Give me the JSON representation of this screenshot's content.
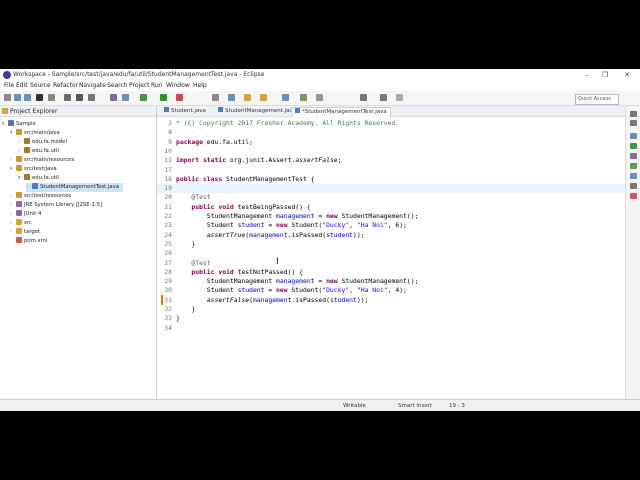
{
  "window": {
    "title": "Workspace - Sample/src/test/java/edu/fa/util/StudentManagementTest.java - Eclipse"
  },
  "menu": [
    "File",
    "Edit",
    "Source",
    "Refactor",
    "Navigate",
    "Search",
    "Project",
    "Run",
    "Window",
    "Help"
  ],
  "quick_access": "Quick Access",
  "explorer": {
    "title": "Project Explorer",
    "items": [
      {
        "label": "Sample"
      },
      {
        "label": "src/main/java"
      },
      {
        "label": "edu.fa.model"
      },
      {
        "label": "edu.fa.util"
      },
      {
        "label": "src/main/resources"
      },
      {
        "label": "src/test/java"
      },
      {
        "label": "edu.fa.util"
      },
      {
        "label": "StudentManagementTest.java"
      },
      {
        "label": "src/test/resources"
      },
      {
        "label": "JRE System Library [J2SE-1.5]"
      },
      {
        "label": "JUnit 4"
      },
      {
        "label": "src"
      },
      {
        "label": "target"
      },
      {
        "label": "pom.xml"
      }
    ]
  },
  "tabs": [
    {
      "label": "Student.java"
    },
    {
      "label": "StudentManagement.java"
    },
    {
      "label": "*StudentManagementTest.java"
    }
  ],
  "editor": {
    "lines": [
      {
        "n": "2",
        "code": "* (C) Copyright 2017 Fresher Academy. All Rights Reserved."
      },
      {
        "n": "8",
        "code": ""
      },
      {
        "n": "9",
        "code": "package edu.fa.util;"
      },
      {
        "n": "10",
        "code": ""
      },
      {
        "n": "11",
        "code": "import static org.junit.Assert.assertFalse;"
      },
      {
        "n": "17",
        "code": ""
      },
      {
        "n": "18",
        "code": "public class StudentManagementTest {"
      },
      {
        "n": "19",
        "code": ""
      },
      {
        "n": "20",
        "code": "    @Test"
      },
      {
        "n": "21",
        "code": "    public void testBeingPassed() {"
      },
      {
        "n": "22",
        "code": "        StudentManagement management = new StudentManagement();"
      },
      {
        "n": "23",
        "code": "        Student student = new Student(\"Ducky\", \"Ha Noi\", 6);"
      },
      {
        "n": "24",
        "code": "        assertTrue(management.isPassed(student));"
      },
      {
        "n": "25",
        "code": "    }"
      },
      {
        "n": "26",
        "code": ""
      },
      {
        "n": "27",
        "code": "    @Test"
      },
      {
        "n": "28",
        "code": "    public void testNotPassed() {"
      },
      {
        "n": "29",
        "code": "        StudentManagement management = new StudentManagement();"
      },
      {
        "n": "30",
        "code": "        Student student = new Student(\"Ducky\", \"Ha Noi\", 4);"
      },
      {
        "n": "31",
        "code": "        assertFalse(management.isPassed(student));"
      },
      {
        "n": "32",
        "code": "    }"
      },
      {
        "n": "33",
        "code": "}"
      },
      {
        "n": "34",
        "code": ""
      }
    ]
  },
  "status": {
    "mode": "Writable",
    "insert": "Smart Insert",
    "position": "19 : 3"
  }
}
